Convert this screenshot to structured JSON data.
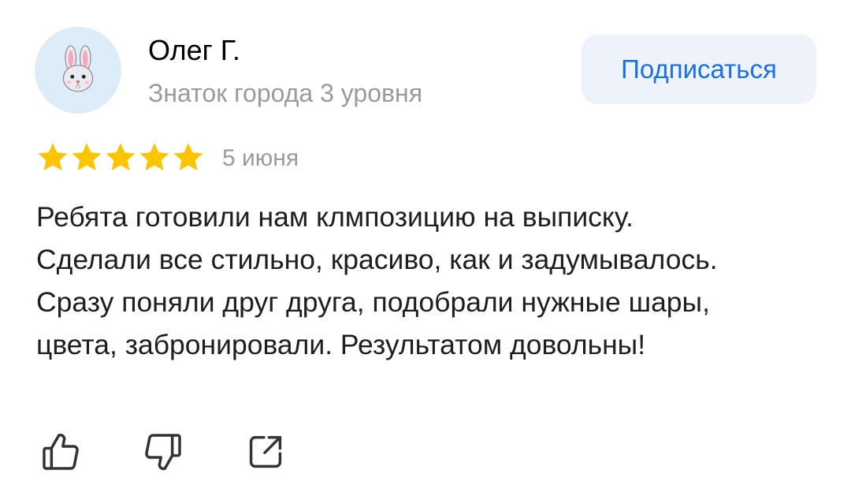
{
  "author": {
    "name": "Олег Г.",
    "level": "Знаток города 3 уровня",
    "avatar_icon": "bunny-avatar-icon",
    "avatar_bg": "#dcecf8"
  },
  "subscribe": {
    "label": "Подписаться",
    "color": "#1a6fe8",
    "bg": "#eef3fb"
  },
  "review": {
    "rating": 5,
    "max_rating": 5,
    "star_color": "#fcc500",
    "date": "5 июня",
    "text": "Ребята готовили нам клмпозицию на выписку. Сделали все стильно, красиво, как и задумывалось. Сразу поняли друг друга, подобрали нужные шары, цвета, забронировали. Результатом довольны!"
  },
  "actions": {
    "icons": [
      "thumbs-up-icon",
      "thumbs-down-icon",
      "share-icon"
    ]
  }
}
